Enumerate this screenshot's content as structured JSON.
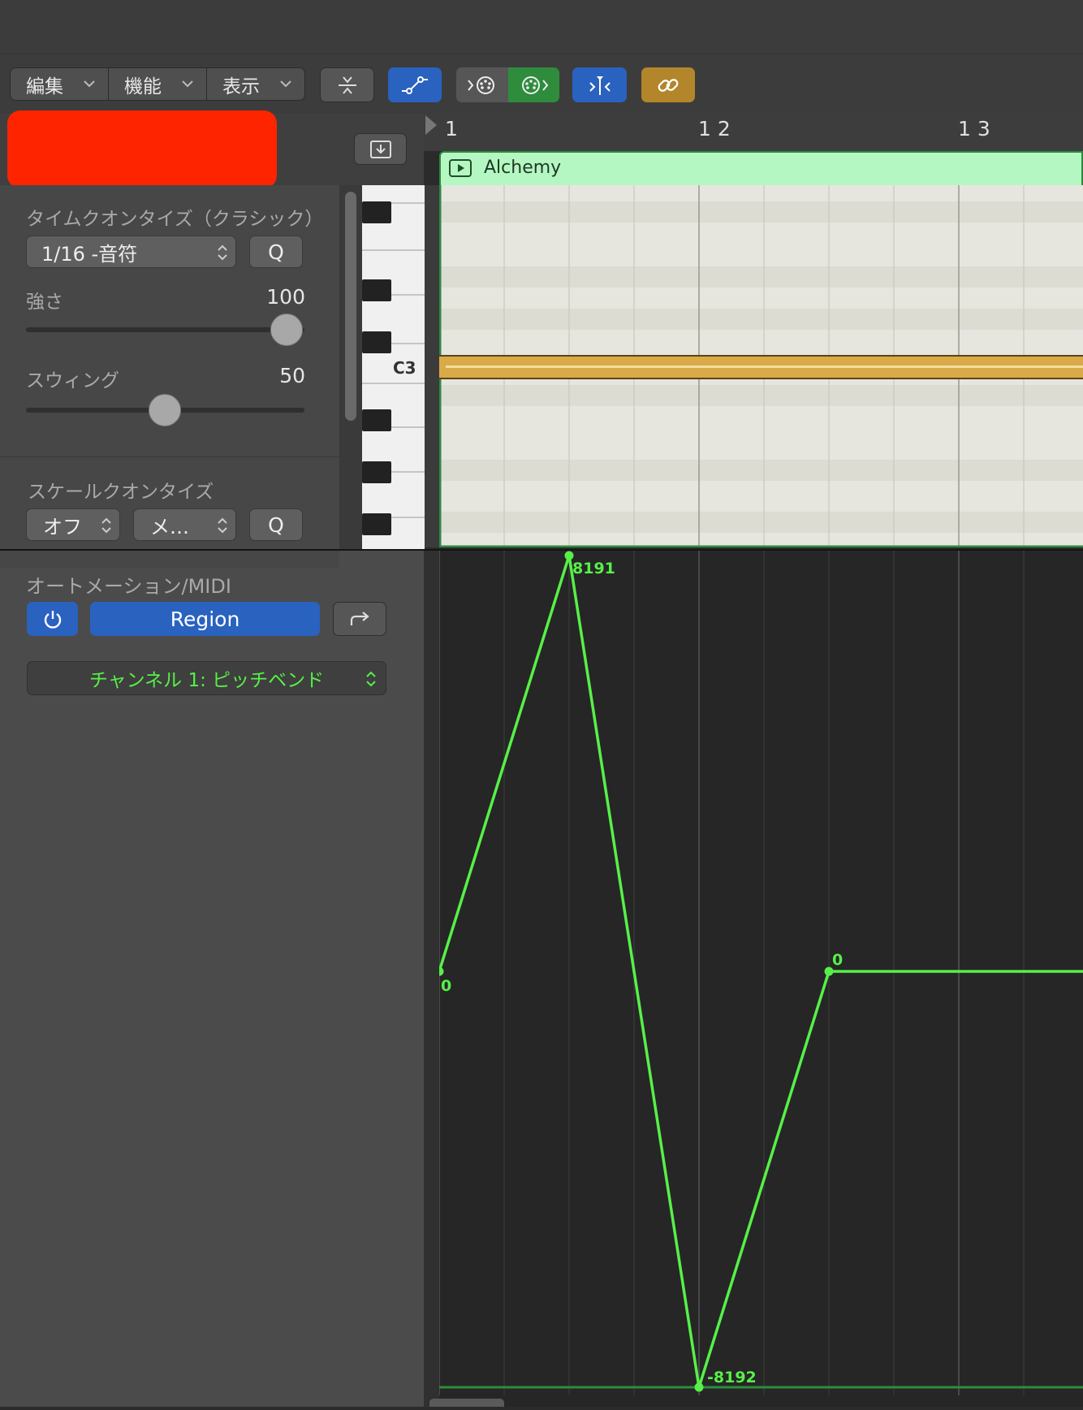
{
  "toolbar": {
    "menus": [
      "編集",
      "機能",
      "表示"
    ],
    "colors": {
      "blue": "#2a62c0",
      "green": "#2e8c3c",
      "gold": "#b3862b",
      "gray": "#565656"
    }
  },
  "inspector": {
    "time_quantize": {
      "title": "タイムクオンタイズ（クラシック）",
      "value": "1/16 -音符",
      "q_label": "Q",
      "strength_label": "強さ",
      "strength_value": "100",
      "strength_level": 1.0,
      "swing_label": "スウィング",
      "swing_value": "50",
      "swing_level": 0.5
    },
    "scale_quantize": {
      "title": "スケールクオンタイズ",
      "root": "オフ",
      "mode": "メ…",
      "q_label": "Q"
    },
    "automation": {
      "title": "オートメーション/MIDI",
      "mode_label": "Region",
      "parameter": "チャンネル 1: ピッチベンド"
    }
  },
  "ruler": {
    "labels": [
      "1",
      "1 2",
      "1 3"
    ]
  },
  "piano": {
    "c3_label": "C3"
  },
  "region": {
    "name": "Alchemy",
    "color": "#b5f7c2"
  },
  "automation_curve": {
    "color": "#57f048",
    "points": [
      {
        "value": 0,
        "label": "0"
      },
      {
        "value": 8191,
        "label": "8191"
      },
      {
        "value": -8192,
        "label": "-8192"
      },
      {
        "value": 0,
        "label": "0"
      }
    ]
  }
}
